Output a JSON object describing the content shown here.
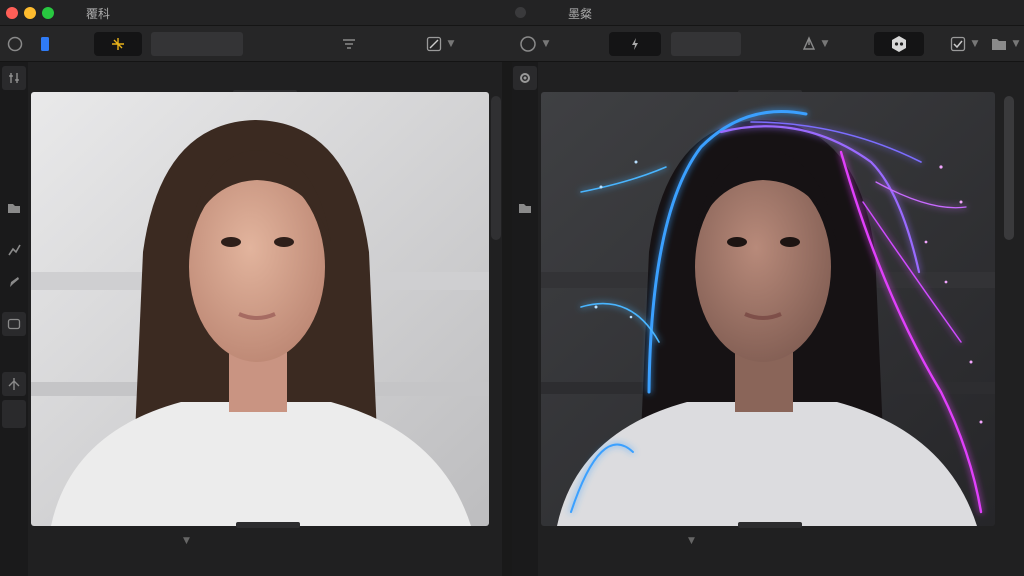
{
  "titlebar": {
    "left_title": "覆科",
    "right_title": "墨粲"
  },
  "toolbar": {
    "left": {
      "circle_icon": "circle-icon",
      "layer_icon": "layer-icon",
      "sparkle_icon": "sparkle-icon",
      "filter_icon": "filter-icon",
      "brush_icon": "brush-icon"
    },
    "right": {
      "circle_icon": "circle-icon",
      "bolt_icon": "bolt-icon",
      "pen_icon": "pen-icon",
      "face_mask_icon": "face-mask-icon",
      "check_icon": "check-icon",
      "folder_icon": "folder-icon"
    }
  },
  "colors": {
    "accent_blue": "#2f7bf6",
    "accent_yellow": "#e8b21a",
    "glow_blue": "#3aa0ff",
    "glow_magenta": "#e040fb"
  },
  "images": {
    "original": "portrait-original",
    "edited": "portrait-glowing-hair"
  }
}
